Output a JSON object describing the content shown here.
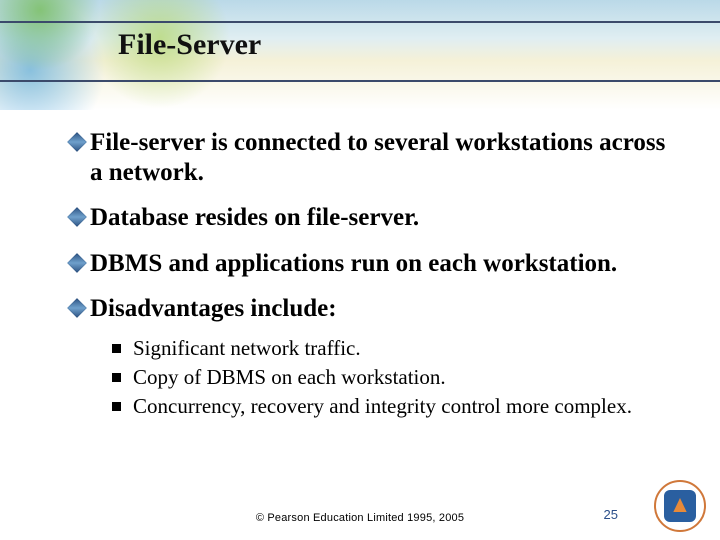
{
  "title": "File-Server",
  "bullets": [
    "File-server is connected to several workstations across a network.",
    "Database resides on file-server.",
    "DBMS and applications run on each workstation.",
    "Disadvantages include:"
  ],
  "sub_bullets": [
    "Significant network traffic.",
    "Copy of DBMS on each workstation.",
    "Concurrency, recovery and integrity control more complex."
  ],
  "copyright": "© Pearson Education Limited 1995, 2005",
  "page_number": "25"
}
